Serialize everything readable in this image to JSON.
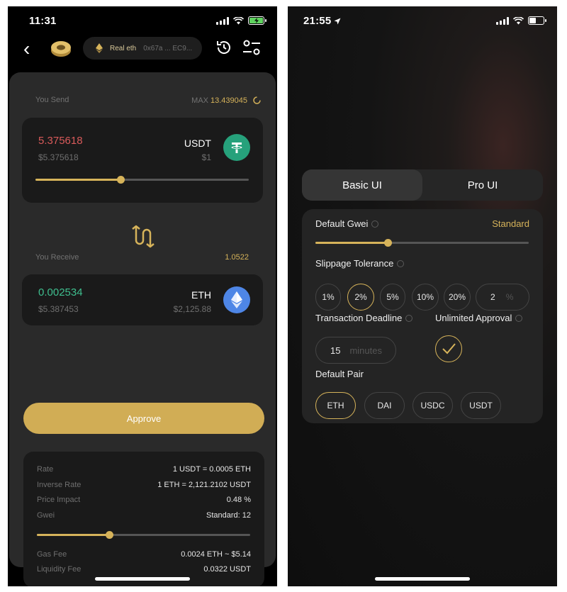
{
  "left": {
    "status_time": "11:31",
    "chain_pill": {
      "network": "Real eth",
      "address": "0x67a ... EC9..."
    },
    "send": {
      "label": "You Send",
      "max_label": "MAX",
      "max_value": "13.439045",
      "amount": "5.375618",
      "amount_usd": "$5.375618",
      "token": "USDT",
      "token_price": "$1",
      "slider_fraction": 0.4
    },
    "receive": {
      "label": "You Receive",
      "ratio": "1.0522",
      "amount": "0.002534",
      "amount_usd": "$5.387453",
      "token": "ETH",
      "token_price": "$2,125.88"
    },
    "approve_label": "Approve",
    "details": {
      "rate_label": "Rate",
      "rate_value": "1 USDT = 0.0005 ETH",
      "inverse_label": "Inverse Rate",
      "inverse_value": "1 ETH = 2,121.2102 USDT",
      "impact_label": "Price Impact",
      "impact_value": "0.48 %",
      "gwei_label": "Gwei",
      "gwei_value": "Standard: 12",
      "gwei_slider_fraction": 0.34,
      "gas_label": "Gas Fee",
      "gas_value": "0.0024 ETH ~ $5.14",
      "liq_label": "Liquidity Fee",
      "liq_value": "0.0322 USDT"
    }
  },
  "right": {
    "status_time": "21:55",
    "tabs": [
      "Basic UI",
      "Pro UI"
    ],
    "default_gwei": {
      "label": "Default Gwei",
      "value": "Standard",
      "slider_fraction": 0.34
    },
    "slippage": {
      "label": "Slippage Tolerance",
      "options": [
        "1%",
        "2%",
        "5%",
        "10%",
        "20%"
      ],
      "selected": "2%",
      "custom_value": "2",
      "custom_unit": "%"
    },
    "deadline": {
      "label": "Transaction Deadline",
      "value": "15",
      "unit": "minutes"
    },
    "unlimited_approval": {
      "label": "Unlimited Approval",
      "checked": true
    },
    "default_pair": {
      "label": "Default Pair",
      "options": [
        "ETH",
        "DAI",
        "USDC",
        "USDT"
      ],
      "selected": "ETH"
    }
  },
  "colors": {
    "accent": "#d6b35a",
    "send_amount": "#d85a5a",
    "receive_amount": "#3fbf8f",
    "tether": "#26a17b",
    "eth": "#4e86e6",
    "battery_charging": "#5fd35f"
  }
}
